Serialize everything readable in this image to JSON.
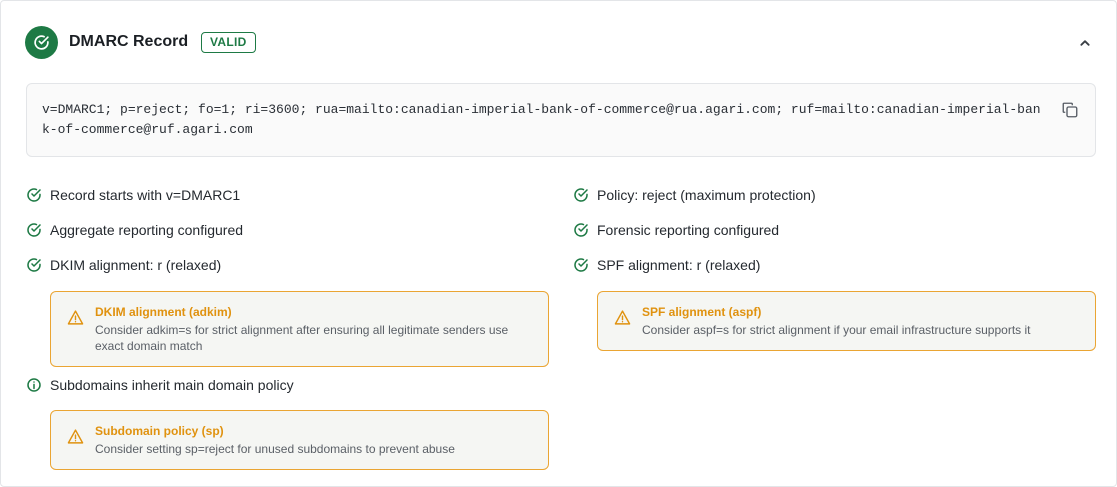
{
  "header": {
    "title": "DMARC Record",
    "badge": "VALID"
  },
  "record": {
    "value": "v=DMARC1; p=reject; fo=1; ri=3600; rua=mailto:canadian-imperial-bank-of-commerce@rua.agari.com; ruf=mailto:canadian-imperial-bank-of-commerce@ruf.agari.com"
  },
  "checks_left": [
    {
      "label": "Record starts with v=DMARC1",
      "icon": "check-circle-icon"
    },
    {
      "label": "Aggregate reporting configured",
      "icon": "check-circle-icon"
    },
    {
      "label": "DKIM alignment: r (relaxed)",
      "icon": "check-circle-icon"
    },
    {
      "label": "Subdomains inherit main domain policy",
      "icon": "info-circle-icon"
    }
  ],
  "checks_right": [
    {
      "label": "Policy: reject (maximum protection)",
      "icon": "check-circle-icon"
    },
    {
      "label": "Forensic reporting configured",
      "icon": "check-circle-icon"
    },
    {
      "label": "SPF alignment: r (relaxed)",
      "icon": "check-circle-icon"
    }
  ],
  "warnings": {
    "dkim": {
      "title": "DKIM alignment (adkim)",
      "text": "Consider adkim=s for strict alignment after ensuring all legitimate senders use exact domain match"
    },
    "spf": {
      "title": "SPF alignment (aspf)",
      "text": "Consider aspf=s for strict alignment if your email infrastructure supports it"
    },
    "subdomain": {
      "title": "Subdomain policy (sp)",
      "text": "Consider setting sp=reject for unused subdomains to prevent abuse"
    }
  },
  "colors": {
    "success": "#1e7a45",
    "warning": "#e0920f",
    "warning_border": "#eaa533"
  }
}
